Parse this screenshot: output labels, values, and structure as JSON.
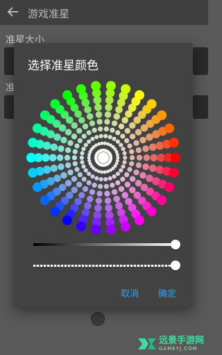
{
  "background": {
    "title": "游戏准星",
    "section1": "准星大小",
    "section2": "准"
  },
  "dialog": {
    "title": "选择准星颜色",
    "value_slider_level": 1.0,
    "alpha_slider_level": 1.0,
    "cancel": "取消",
    "confirm": "确定"
  },
  "watermark": {
    "main": "远景手游网",
    "sub": "GAMEYJ.COM"
  },
  "colors": {
    "accent": "#2fa3ea",
    "dialog_bg": "#424242",
    "watermark": "#44d7a2"
  }
}
